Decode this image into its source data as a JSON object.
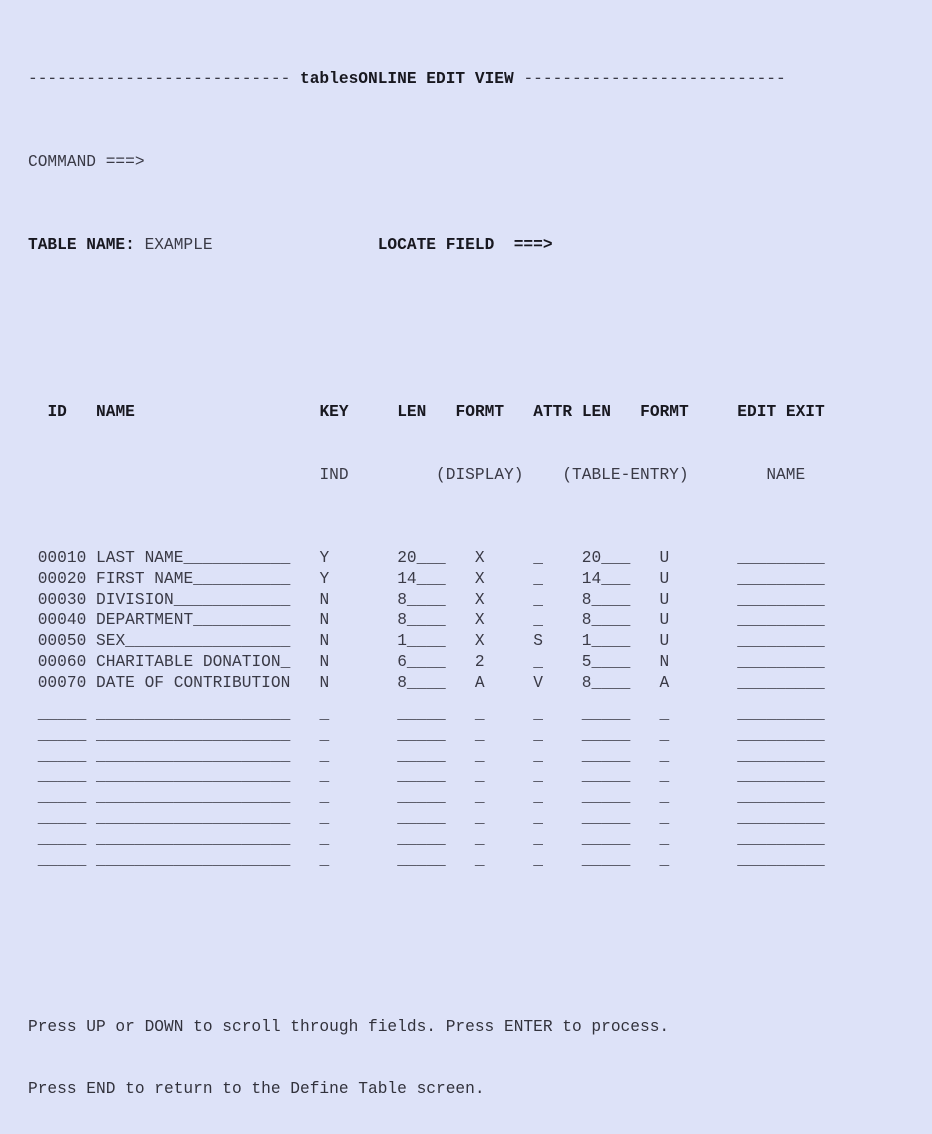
{
  "screen": {
    "title_dashes_left": "---------------------------",
    "title_text": "tablesONLINE EDIT VIEW",
    "title_dashes_right": "---------------------------",
    "command_label": "COMMAND ===>",
    "command_value": "",
    "table_name_label": "TABLE NAME:",
    "table_name_value": "EXAMPLE",
    "locate_field_label": "LOCATE FIELD  ===>",
    "locate_field_value": "",
    "background_color": "#dde2f8",
    "text_color": "#32323c"
  },
  "headers": {
    "row1": {
      "id": "ID",
      "name": "NAME",
      "key": "KEY",
      "len_display": "LEN",
      "formt_display": "FORMT",
      "attr": "ATTR",
      "len_entry": "LEN",
      "formt_entry": "FORMT",
      "edit_exit": "EDIT EXIT"
    },
    "row2": {
      "key_ind": "IND",
      "display_group": "(DISPLAY)",
      "entry_group": "(TABLE-ENTRY)",
      "exit_name": "NAME"
    }
  },
  "field_widths": {
    "id": 5,
    "name": 20,
    "key_ind": 1,
    "len": 5,
    "formt": 1,
    "attr": 1,
    "edit_exit_name": 9
  },
  "rows": [
    {
      "id": "00010",
      "name": "LAST NAME",
      "key_ind": "Y",
      "len_display": "20",
      "formt_display": "X",
      "attr": "",
      "len_entry": "20",
      "formt_entry": "U",
      "edit_exit_name": ""
    },
    {
      "id": "00020",
      "name": "FIRST NAME",
      "key_ind": "Y",
      "len_display": "14",
      "formt_display": "X",
      "attr": "",
      "len_entry": "14",
      "formt_entry": "U",
      "edit_exit_name": ""
    },
    {
      "id": "00030",
      "name": "DIVISION",
      "key_ind": "N",
      "len_display": "8",
      "formt_display": "X",
      "attr": "",
      "len_entry": "8",
      "formt_entry": "U",
      "edit_exit_name": ""
    },
    {
      "id": "00040",
      "name": "DEPARTMENT",
      "key_ind": "N",
      "len_display": "8",
      "formt_display": "X",
      "attr": "",
      "len_entry": "8",
      "formt_entry": "U",
      "edit_exit_name": ""
    },
    {
      "id": "00050",
      "name": "SEX",
      "key_ind": "N",
      "len_display": "1",
      "formt_display": "X",
      "attr": "S",
      "len_entry": "1",
      "formt_entry": "U",
      "edit_exit_name": ""
    },
    {
      "id": "00060",
      "name": "CHARITABLE DONATION",
      "key_ind": "N",
      "len_display": "6",
      "formt_display": "2",
      "attr": "",
      "len_entry": "5",
      "formt_entry": "N",
      "edit_exit_name": ""
    },
    {
      "id": "00070",
      "name": "DATE OF CONTRIBUTION",
      "key_ind": "N",
      "len_display": "8",
      "formt_display": "A",
      "attr": "V",
      "len_entry": "8",
      "formt_entry": "A",
      "edit_exit_name": ""
    },
    {
      "id": "",
      "name": "",
      "key_ind": "",
      "len_display": "",
      "formt_display": "",
      "attr": "",
      "len_entry": "",
      "formt_entry": "",
      "edit_exit_name": ""
    },
    {
      "id": "",
      "name": "",
      "key_ind": "",
      "len_display": "",
      "formt_display": "",
      "attr": "",
      "len_entry": "",
      "formt_entry": "",
      "edit_exit_name": ""
    },
    {
      "id": "",
      "name": "",
      "key_ind": "",
      "len_display": "",
      "formt_display": "",
      "attr": "",
      "len_entry": "",
      "formt_entry": "",
      "edit_exit_name": ""
    },
    {
      "id": "",
      "name": "",
      "key_ind": "",
      "len_display": "",
      "formt_display": "",
      "attr": "",
      "len_entry": "",
      "formt_entry": "",
      "edit_exit_name": ""
    },
    {
      "id": "",
      "name": "",
      "key_ind": "",
      "len_display": "",
      "formt_display": "",
      "attr": "",
      "len_entry": "",
      "formt_entry": "",
      "edit_exit_name": ""
    },
    {
      "id": "",
      "name": "",
      "key_ind": "",
      "len_display": "",
      "formt_display": "",
      "attr": "",
      "len_entry": "",
      "formt_entry": "",
      "edit_exit_name": ""
    },
    {
      "id": "",
      "name": "",
      "key_ind": "",
      "len_display": "",
      "formt_display": "",
      "attr": "",
      "len_entry": "",
      "formt_entry": "",
      "edit_exit_name": ""
    },
    {
      "id": "",
      "name": "",
      "key_ind": "",
      "len_display": "",
      "formt_display": "",
      "attr": "",
      "len_entry": "",
      "formt_entry": "",
      "edit_exit_name": ""
    }
  ],
  "footer": {
    "line1": "Press UP or DOWN to scroll through fields. Press ENTER to process.",
    "line2": "Press END to return to the Define Table screen."
  }
}
